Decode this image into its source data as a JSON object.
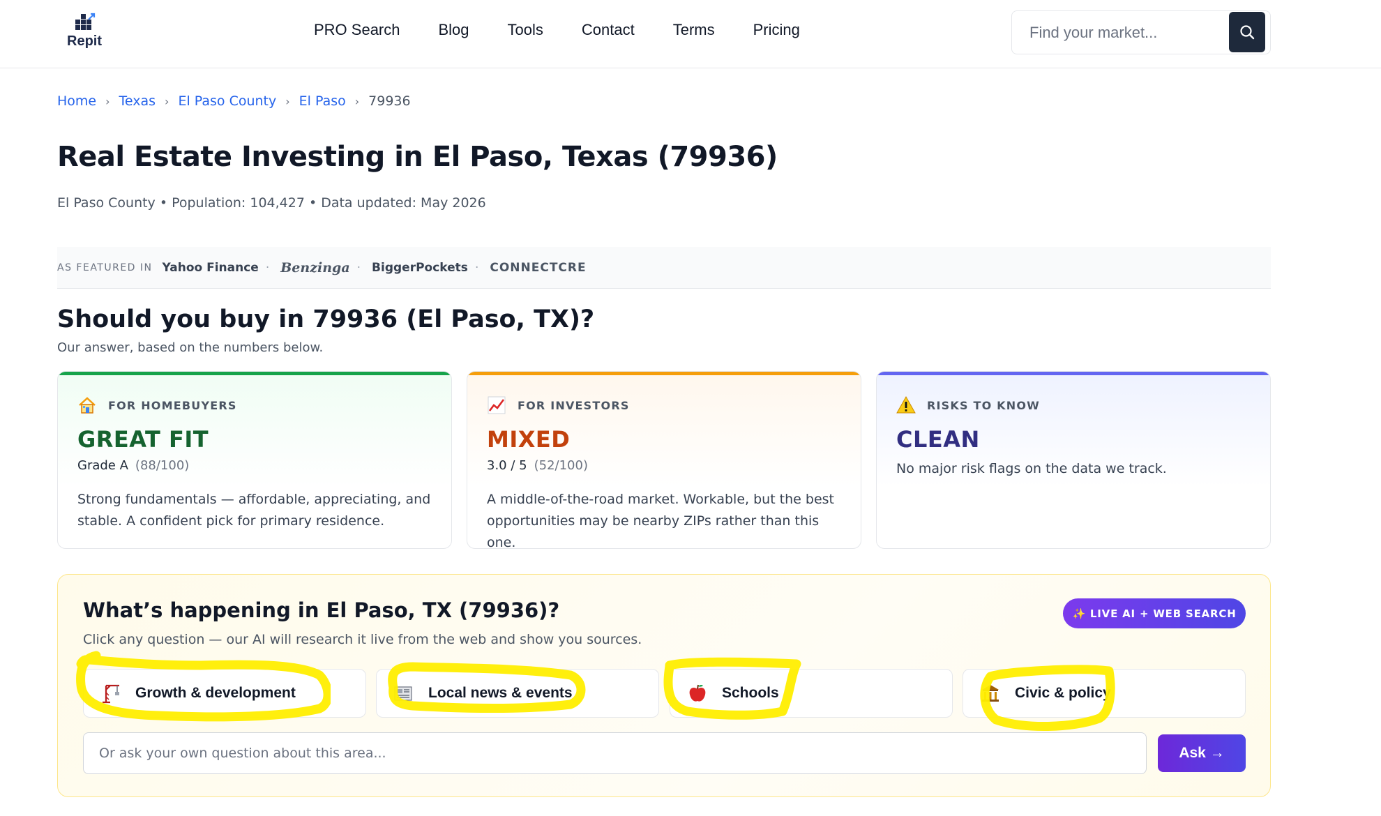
{
  "header": {
    "logo_text": "Repit",
    "nav": [
      "PRO Search",
      "Blog",
      "Tools",
      "Contact",
      "Terms",
      "Pricing"
    ],
    "search_placeholder": "Find your market..."
  },
  "breadcrumb": {
    "items": [
      "Home",
      "Texas",
      "El Paso County",
      "El Paso"
    ],
    "current": "79936",
    "separator": "›"
  },
  "page": {
    "title": "Real Estate Investing in El Paso, Texas (79936)",
    "meta": "El Paso County • Population: 104,427 • Data updated: May 2026"
  },
  "featured": {
    "label": "AS FEATURED IN",
    "outlets": [
      "Yahoo Finance",
      "Benzinga",
      "BiggerPockets",
      "CONNECTCRE"
    ],
    "separator": "·"
  },
  "buy_section": {
    "title": "Should you buy in 79936 (El Paso, TX)?",
    "subtitle": "Our answer, based on the numbers below.",
    "cards": [
      {
        "label": "FOR HOMEBUYERS",
        "icon": "house-icon",
        "verdict": "GREAT FIT",
        "grade": "Grade A",
        "score": "(88/100)",
        "description": "Strong fundamentals — affordable, appreciating, and stable. A confident pick for primary residence.",
        "accent": "#16a34a"
      },
      {
        "label": "FOR INVESTORS",
        "icon": "chart-up-icon",
        "verdict": "MIXED",
        "grade": "3.0 / 5",
        "score": "(52/100)",
        "description": "A middle-of-the-road market. Workable, but the best opportunities may be nearby ZIPs rather than this one.",
        "accent": "#f59e0b"
      },
      {
        "label": "RISKS TO KNOW",
        "icon": "warning-icon",
        "verdict": "CLEAN",
        "description": "No major risk flags on the data we track.",
        "accent": "#6366f1"
      }
    ]
  },
  "happening": {
    "title": "What’s happening in El Paso, TX (79936)?",
    "subtitle": "Click any question — our AI will research it live from the web and show you sources.",
    "badge": "LIVE AI + WEB SEARCH",
    "badge_icon": "sparkle-icon",
    "chips": [
      {
        "label": "Growth & development",
        "icon": "crane-icon"
      },
      {
        "label": "Local news & events",
        "icon": "newspaper-icon"
      },
      {
        "label": "Schools",
        "icon": "apple-icon"
      },
      {
        "label": "Civic & policy",
        "icon": "government-building-icon"
      }
    ],
    "ask_placeholder": "Or ask your own question about this area...",
    "ask_button": "Ask →"
  },
  "colors": {
    "highlight": "#ffee00",
    "brand_purple": "#4f46e5",
    "link": "#2563eb"
  }
}
